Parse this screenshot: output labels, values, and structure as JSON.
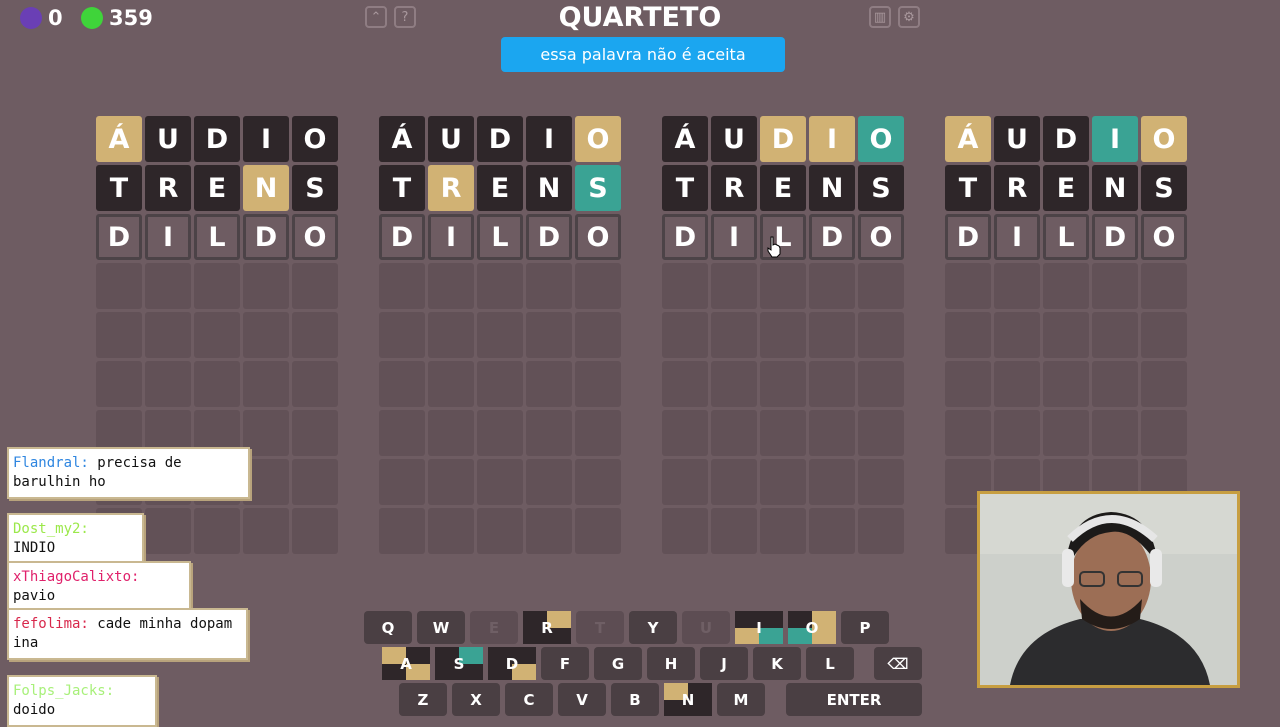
{
  "header": {
    "title": "QUARTETO",
    "counter_purple": "0",
    "counter_green": "359",
    "toast": "essa palavra não é aceita"
  },
  "boards": [
    {
      "rows": [
        [
          [
            "Á",
            "yellow"
          ],
          [
            "U",
            "dark"
          ],
          [
            "D",
            "dark"
          ],
          [
            "I",
            "dark"
          ],
          [
            "O",
            "dark"
          ]
        ],
        [
          [
            "T",
            "dark"
          ],
          [
            "R",
            "dark"
          ],
          [
            "E",
            "dark"
          ],
          [
            "N",
            "yellow"
          ],
          [
            "S",
            "dark"
          ]
        ],
        [
          [
            "D",
            "typed"
          ],
          [
            "I",
            "typed"
          ],
          [
            "L",
            "typed"
          ],
          [
            "D",
            "typed"
          ],
          [
            "O",
            "typed"
          ]
        ]
      ]
    },
    {
      "rows": [
        [
          [
            "Á",
            "dark"
          ],
          [
            "U",
            "dark"
          ],
          [
            "D",
            "dark"
          ],
          [
            "I",
            "dark"
          ],
          [
            "O",
            "yellow"
          ]
        ],
        [
          [
            "T",
            "dark"
          ],
          [
            "R",
            "yellow"
          ],
          [
            "E",
            "dark"
          ],
          [
            "N",
            "dark"
          ],
          [
            "S",
            "green"
          ]
        ],
        [
          [
            "D",
            "typed"
          ],
          [
            "I",
            "typed"
          ],
          [
            "L",
            "typed"
          ],
          [
            "D",
            "typed"
          ],
          [
            "O",
            "typed"
          ]
        ]
      ]
    },
    {
      "rows": [
        [
          [
            "Á",
            "dark"
          ],
          [
            "U",
            "dark"
          ],
          [
            "D",
            "yellow"
          ],
          [
            "I",
            "yellow"
          ],
          [
            "O",
            "green"
          ]
        ],
        [
          [
            "T",
            "dark"
          ],
          [
            "R",
            "dark"
          ],
          [
            "E",
            "dark"
          ],
          [
            "N",
            "dark"
          ],
          [
            "S",
            "dark"
          ]
        ],
        [
          [
            "D",
            "typed"
          ],
          [
            "I",
            "typed"
          ],
          [
            "L",
            "typed"
          ],
          [
            "D",
            "typed"
          ],
          [
            "O",
            "typed"
          ]
        ]
      ]
    },
    {
      "rows": [
        [
          [
            "Á",
            "yellow"
          ],
          [
            "U",
            "dark"
          ],
          [
            "D",
            "dark"
          ],
          [
            "I",
            "green"
          ],
          [
            "O",
            "yellow"
          ]
        ],
        [
          [
            "T",
            "dark"
          ],
          [
            "R",
            "dark"
          ],
          [
            "E",
            "dark"
          ],
          [
            "N",
            "dark"
          ],
          [
            "S",
            "dark"
          ]
        ],
        [
          [
            "D",
            "typed"
          ],
          [
            "I",
            "typed"
          ],
          [
            "L",
            "typed"
          ],
          [
            "D",
            "typed"
          ],
          [
            "O",
            "typed"
          ]
        ]
      ]
    }
  ],
  "chat": [
    {
      "user": "Flandral:",
      "color": "#2f86e0",
      "msg": "precisa de barulhin ho"
    },
    {
      "user": "Dost_my2:",
      "color": "#9be84a",
      "msg": "INDIO"
    },
    {
      "user": "xThiagoCalixto:",
      "color": "#e0216b",
      "msg": "pavio"
    },
    {
      "user": "fefolima:",
      "color": "#d8284c",
      "msg": "cade minha dopam ina"
    },
    {
      "user": "Folps_Jacks:",
      "color": "#a8f07a",
      "msg": "doido"
    }
  ],
  "keyboard": {
    "rows": [
      [
        "Q",
        "W",
        "E",
        "R",
        "T",
        "Y",
        "U",
        "I",
        "O",
        "P"
      ],
      [
        "A",
        "S",
        "D",
        "F",
        "G",
        "H",
        "J",
        "K",
        "L",
        "⌫"
      ],
      [
        "Z",
        "X",
        "C",
        "V",
        "B",
        "N",
        "M",
        "ENTER"
      ]
    ]
  },
  "colors": {
    "yellow": "#d1b274",
    "green": "#3aa394",
    "dark": "#2e2629",
    "key": "#4a3f43"
  }
}
